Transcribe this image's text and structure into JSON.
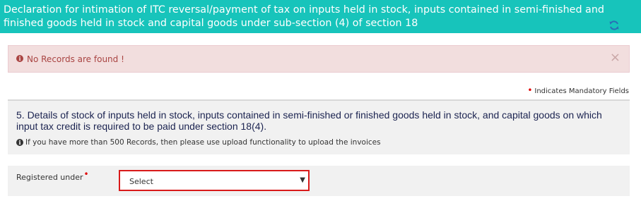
{
  "header": {
    "title": "Declaration for intimation of ITC reversal/payment of tax on inputs held in stock, inputs contained in semi-finished and finished goods held in stock and capital goods under sub-section (4) of section 18",
    "refresh_icon": "refresh-icon"
  },
  "alert": {
    "message": "No Records are found !",
    "close_symbol": "×",
    "info_symbol": "i"
  },
  "mandatory_note": {
    "marker": "•",
    "text": "Indicates Mandatory Fields"
  },
  "section5": {
    "title": "5. Details of stock of inputs held in stock, inputs contained in semi-finished or finished goods held in stock, and capital goods on which input tax credit is required to be paid under section 18(4).",
    "note": "If you have more than 500 Records, then please use upload functionality to upload the invoices",
    "info_symbol": "i"
  },
  "registered_under": {
    "label": "Registered under",
    "required_marker": "•",
    "selected": "Select",
    "arrow": "▼"
  },
  "colors": {
    "header_bg": "#17c4bb",
    "alert_bg": "#f2dede",
    "alert_text": "#a94442",
    "required": "#e00000",
    "select_border": "#d91a1a"
  }
}
